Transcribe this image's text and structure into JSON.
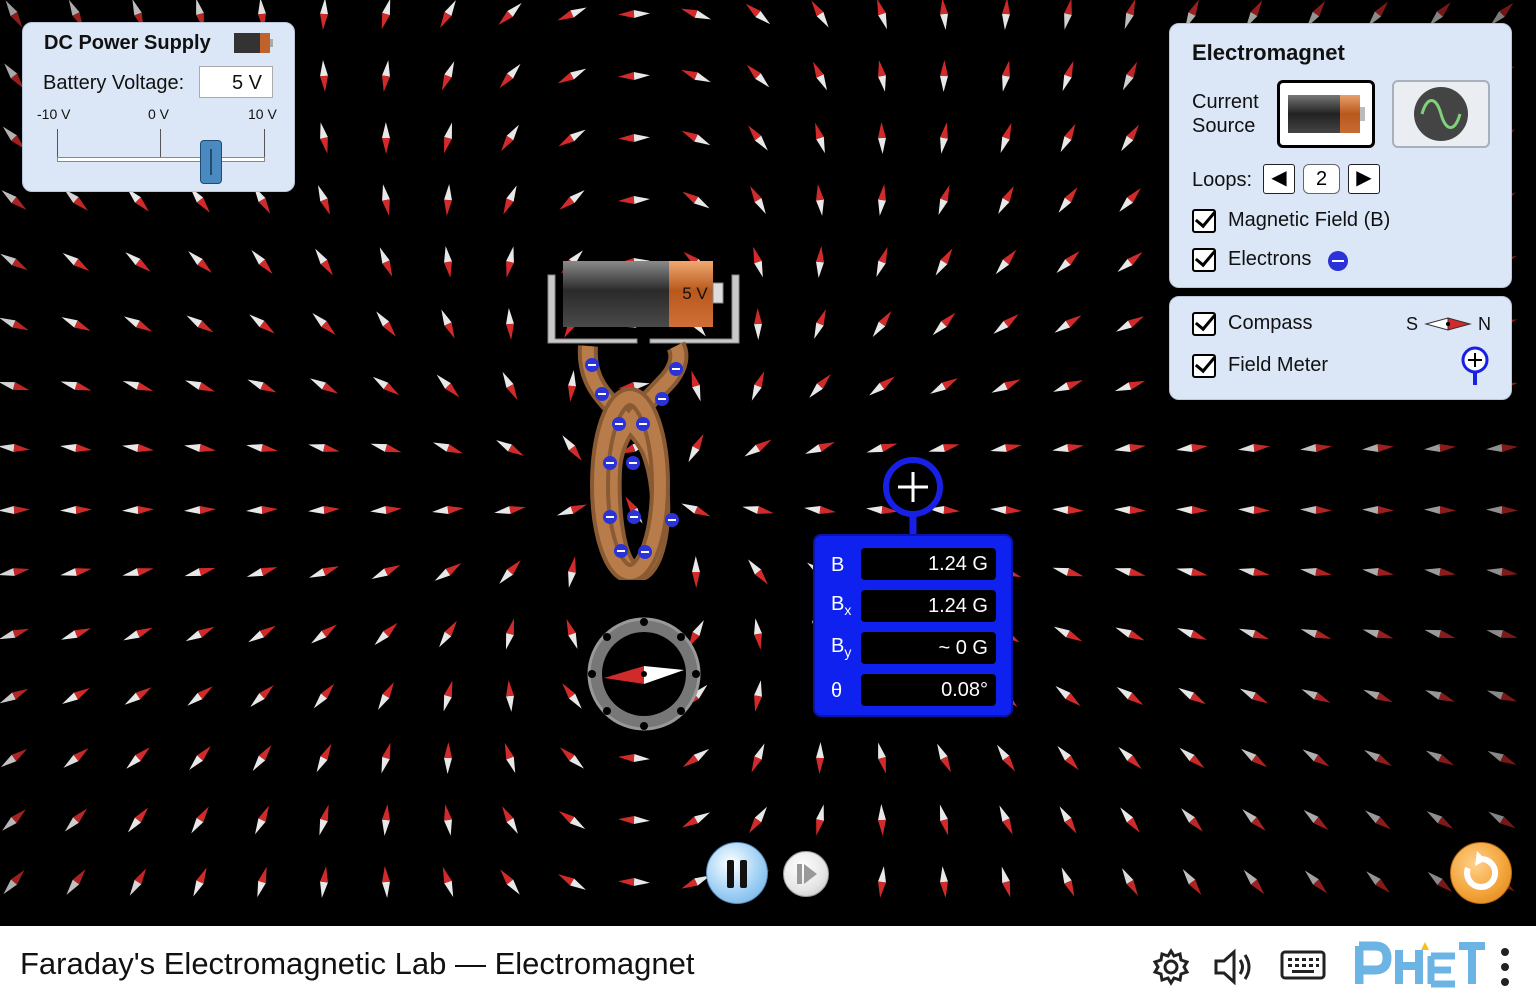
{
  "dc_power_supply": {
    "title": "DC Power Supply",
    "voltage_label": "Battery Voltage:",
    "voltage_value": "5 V",
    "ticks": [
      "-10 V",
      "0 V",
      "10 V"
    ],
    "slider": {
      "min": -10,
      "max": 10,
      "value": 5
    }
  },
  "electromagnet": {
    "title": "Electromagnet",
    "current_source_label": [
      "Current",
      "Source"
    ],
    "loops_label": "Loops:",
    "loops_value": "2",
    "magnetic_field_label": "Magnetic Field (B)",
    "electrons_label": "Electrons",
    "current_source_selected": "battery"
  },
  "tools": {
    "compass_label": "Compass",
    "compass_s": "S",
    "compass_n": "N",
    "field_meter_label": "Field Meter"
  },
  "battery": {
    "label": "5 V"
  },
  "field_meter": {
    "rows": [
      {
        "label": "B",
        "sub": "",
        "value": "1.24 G"
      },
      {
        "label": "B",
        "sub": "x",
        "value": "1.24 G"
      },
      {
        "label": "B",
        "sub": "y",
        "value": "~ 0 G"
      },
      {
        "label": "θ",
        "sub": "",
        "value": "0.08°"
      }
    ]
  },
  "navbar": {
    "title": "Faraday's Electromagnetic Lab — Electromagnet"
  },
  "colors": {
    "panel": "#dbe6f6",
    "meter": "#0e21ee",
    "reset": "#f3a53c",
    "phet_blue": "#6cb4e4",
    "phet_yellow": "#f2c21b"
  }
}
